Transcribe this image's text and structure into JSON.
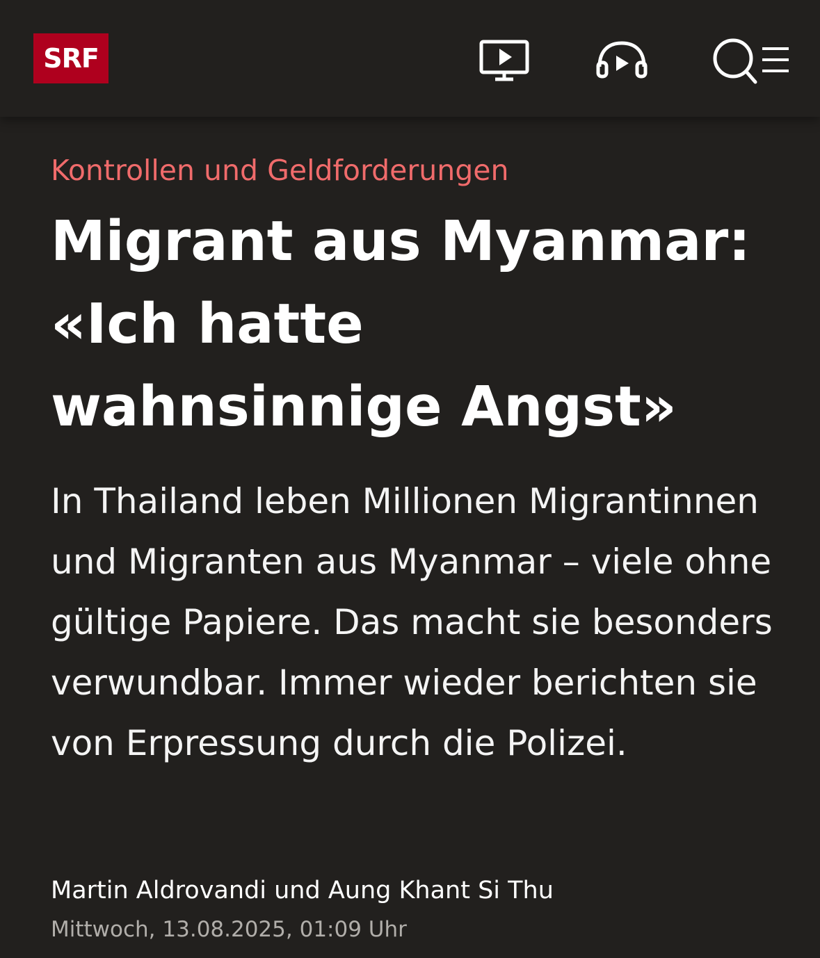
{
  "header": {
    "logo_text": "SRF",
    "logo_color": "#af001e",
    "icons": [
      "tv-play-icon",
      "audio-headphones-icon",
      "search-icon",
      "menu-icon"
    ]
  },
  "article": {
    "kicker": "Kontrollen und Geldforderungen",
    "kicker_color": "#f06b6b",
    "title": "Migrant aus Myanmar: «Ich hatte wahnsinnige Angst»",
    "lead": "In Thailand leben Millionen Migrantinnen und Migranten aus Myanmar – viele ohne gültige Papiere. Das macht sie besonders verwundbar. Immer wieder berichten sie von Erpressung durch die Polizei.",
    "author": "Martin Aldrovandi und Aung Khant Si Thu",
    "timestamp": "Mittwoch, 13.08.2025, 01:09 Uhr"
  },
  "colors": {
    "background": "#22201e",
    "text": "#ffffff",
    "muted": "#b1aeaa"
  }
}
